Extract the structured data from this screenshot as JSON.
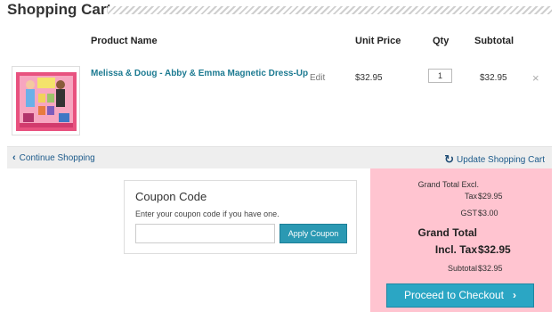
{
  "page": {
    "title": "Shopping Cart"
  },
  "table": {
    "headers": {
      "product_name": "Product Name",
      "unit_price": "Unit Price",
      "qty": "Qty",
      "subtotal": "Subtotal"
    },
    "rows": [
      {
        "product_name": "Melissa & Doug - Abby & Emma Magnetic Dress-Up",
        "edit_label": "Edit",
        "unit_price": "$32.95",
        "qty": "1",
        "subtotal": "$32.95",
        "remove_icon": "×"
      }
    ]
  },
  "actions": {
    "continue_label": "Continue Shopping",
    "continue_icon": "‹",
    "update_label": "Update Shopping Cart",
    "update_icon": "↻"
  },
  "coupon": {
    "title": "Coupon Code",
    "help": "Enter your coupon code if you have one.",
    "input_value": "",
    "button_label": "Apply Coupon"
  },
  "totals": {
    "grand_excl_line1": "Grand Total Excl.",
    "grand_excl_line2": "Tax",
    "grand_excl_value": "$29.95",
    "gst_label": "GST",
    "gst_value": "$3.00",
    "grand_incl_line1": "Grand Total",
    "grand_incl_line2": "Incl. Tax",
    "grand_incl_value": "$32.95",
    "subtotal_label": "Subtotal",
    "subtotal_value": "$32.95",
    "checkout_label": "Proceed to Checkout",
    "checkout_icon": "›"
  },
  "colors": {
    "accent": "#2ba6c4",
    "link": "#1c7a91",
    "totals_bg": "#ffc4d0",
    "actions_bg": "#eeeeee"
  }
}
